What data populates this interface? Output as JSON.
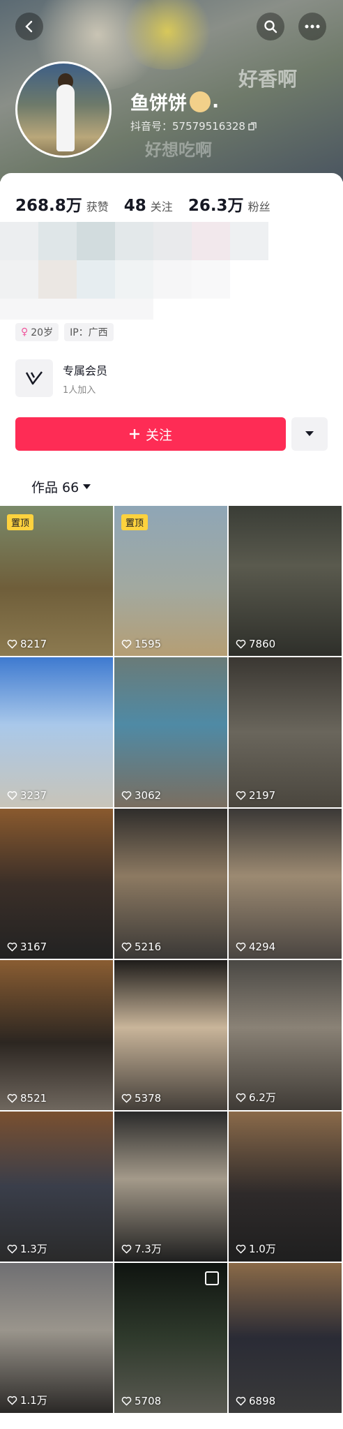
{
  "banner": {
    "overlay_text_1": "好香啊",
    "overlay_text_2": "好想吃啊"
  },
  "profile": {
    "name": "鱼饼饼",
    "name_suffix": ".",
    "douyin_id": "抖音号：57579516328",
    "stats": [
      {
        "value": "268.8万",
        "label": "获赞"
      },
      {
        "value": "48",
        "label": "关注"
      },
      {
        "value": "26.3万",
        "label": "粉丝"
      }
    ],
    "tags": {
      "age": "20岁",
      "ip": "IP：广西"
    },
    "member": {
      "title": "专属会员",
      "subtitle": "1人加入"
    },
    "follow_label": "关注"
  },
  "works_tab": {
    "label": "作品 66"
  },
  "videos": [
    {
      "likes": "8217",
      "pinned": "置顶"
    },
    {
      "likes": "1595",
      "pinned": "置顶"
    },
    {
      "likes": "7860"
    },
    {
      "likes": "3237"
    },
    {
      "likes": "3062"
    },
    {
      "likes": "2197"
    },
    {
      "likes": "3167"
    },
    {
      "likes": "5216"
    },
    {
      "likes": "4294"
    },
    {
      "likes": "8521"
    },
    {
      "likes": "5378"
    },
    {
      "likes": "6.2万"
    },
    {
      "likes": "1.3万"
    },
    {
      "likes": "7.3万"
    },
    {
      "likes": "1.0万"
    },
    {
      "likes": "1.1万"
    },
    {
      "likes": "5708"
    },
    {
      "likes": "6898"
    }
  ],
  "colors": {
    "accent": "#fe2c55",
    "pin": "#fdd23e"
  }
}
